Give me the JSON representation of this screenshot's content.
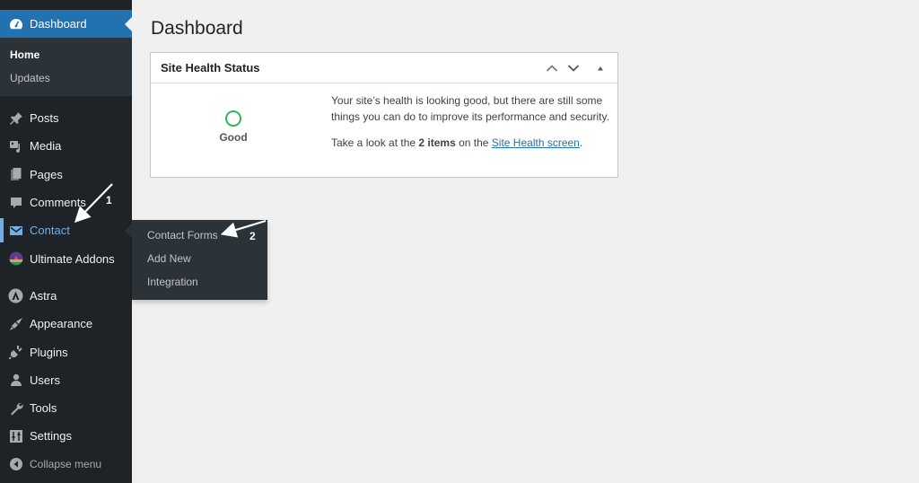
{
  "sidebar": {
    "dashboard": {
      "label": "Dashboard",
      "icon": "dashboard-gauge-icon"
    },
    "dashboard_submenu": [
      {
        "label": "Home",
        "current": true
      },
      {
        "label": "Updates",
        "current": false
      }
    ],
    "items": [
      {
        "label": "Posts",
        "icon": "pin-icon"
      },
      {
        "label": "Media",
        "icon": "media-icon"
      },
      {
        "label": "Pages",
        "icon": "pages-icon"
      },
      {
        "label": "Comments",
        "icon": "comment-icon"
      },
      {
        "label": "Contact",
        "icon": "envelope-icon",
        "active": true
      },
      {
        "label": "Ultimate Addons",
        "icon": "ultimate-addons-logo-icon"
      },
      {
        "label": "Astra",
        "icon": "astra-logo-icon"
      },
      {
        "label": "Appearance",
        "icon": "paintbrush-icon"
      },
      {
        "label": "Plugins",
        "icon": "plug-icon"
      },
      {
        "label": "Users",
        "icon": "user-icon"
      },
      {
        "label": "Tools",
        "icon": "wrench-icon"
      },
      {
        "label": "Settings",
        "icon": "sliders-icon"
      }
    ],
    "collapse_label": "Collapse menu"
  },
  "flyout": {
    "items": [
      "Contact Forms",
      "Add New",
      "Integration"
    ]
  },
  "main": {
    "page_title": "Dashboard",
    "site_health": {
      "title": "Site Health Status",
      "status": "Good",
      "description": "Your site’s health is looking good, but there are still some things you can do to improve its performance and security.",
      "cta_prefix": "Take a look at the ",
      "cta_count": "2 items",
      "cta_middle": " on the ",
      "cta_link": "Site Health screen",
      "cta_suffix": "."
    }
  },
  "annotations": {
    "arrow1_label": "1",
    "arrow2_label": "2"
  },
  "colors": {
    "sidebar_bg": "#1d2327",
    "submenu_bg": "#2c3338",
    "accent": "#2271b1",
    "active_text": "#72aee6",
    "good": "#00a32a"
  }
}
